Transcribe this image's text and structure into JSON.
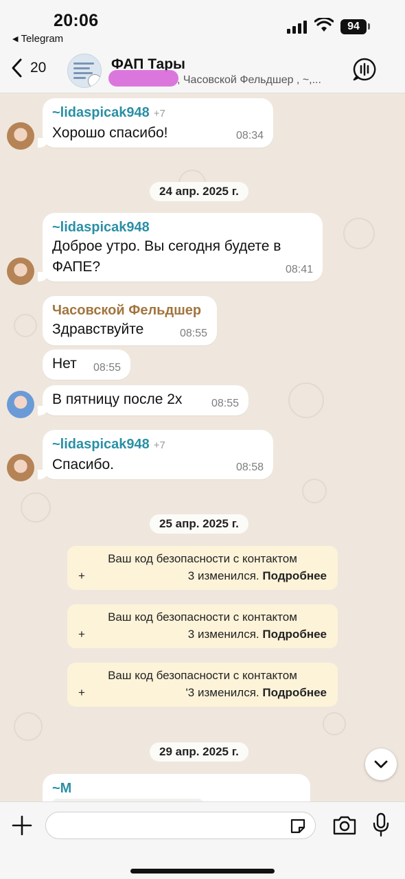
{
  "status_bar": {
    "time": "20:06",
    "back_app": "Telegram",
    "battery": "94"
  },
  "header": {
    "back_count": "20",
    "title": "ФАП Тары",
    "subtitle": ", Часовской Фельдшер , ~,..."
  },
  "messages": [
    {
      "sender": "~lidaspicak948",
      "phone": "+7",
      "text": "Хорошо спасибо!",
      "time": "08:34"
    },
    {
      "sender": "~lidaspicak948",
      "text": "Доброе утро. Вы сегодня будете в ФАПЕ?",
      "time": "08:41"
    },
    {
      "sender": "Часовской Фельдшер",
      "text": "Здравствуйте",
      "time": "08:55"
    },
    {
      "text": "Нет",
      "time": "08:55"
    },
    {
      "text": "В пятницу после 2х",
      "time": "08:55"
    },
    {
      "sender": "~lidaspicak948",
      "phone": "+7",
      "text": "Спасибо.",
      "time": "08:58"
    },
    {
      "sender": "~M"
    }
  ],
  "dates": [
    "24 апр. 2025 г.",
    "25 апр. 2025 г.",
    "29 апр. 2025 г."
  ],
  "system_notices": [
    {
      "line1": "Ваш код безопасности с контактом",
      "prefix": "+",
      "suffix": "3 изменился.",
      "link": "Подробнее"
    },
    {
      "line1": "Ваш код безопасности с контактом",
      "prefix": "+",
      "suffix": "3 изменился.",
      "link": "Подробнее"
    },
    {
      "line1": "Ваш код безопасности с контактом",
      "prefix": "+",
      "suffix": "'3 изменился.",
      "link": "Подробнее"
    }
  ],
  "input": {
    "placeholder": ""
  },
  "icons": {
    "back": "chevron-left-icon",
    "call": "audio-waveform-icon",
    "plus": "plus-icon",
    "sticker": "sticker-icon",
    "camera": "camera-icon",
    "mic": "microphone-icon",
    "scroll": "chevron-down-icon"
  },
  "colors": {
    "chat_background": "#efe7dd",
    "sender_teal": "#2a8fa5",
    "sender_brown": "#a1753f",
    "system_notice": "#fdf3d9"
  }
}
